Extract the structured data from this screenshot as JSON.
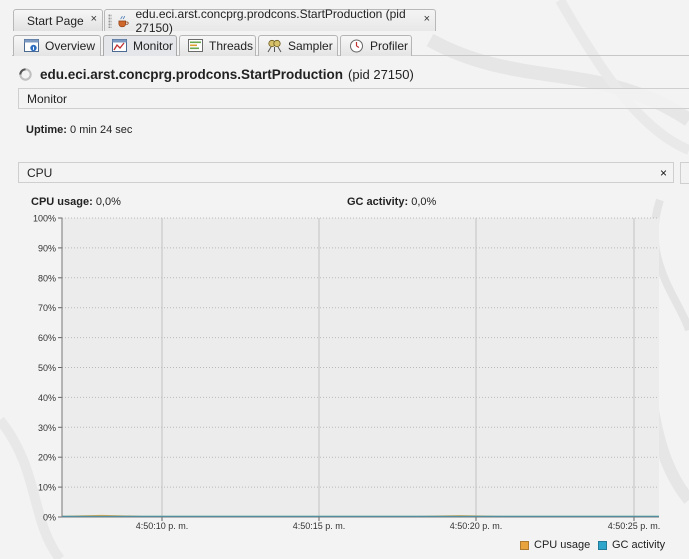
{
  "doc_tabs": {
    "start_page": "Start Page",
    "app_tab": "edu.eci.arst.concprg.prodcons.StartProduction (pid 27150)",
    "close_glyph": "×"
  },
  "sub_tabs": {
    "overview": "Overview",
    "monitor": "Monitor",
    "threads": "Threads",
    "sampler": "Sampler",
    "profiler": "Profiler"
  },
  "header": {
    "app_name": "edu.eci.arst.concprg.prodcons.StartProduction",
    "pid": "(pid 27150)"
  },
  "monitor": {
    "section_label": "Monitor",
    "uptime_label": "Uptime:",
    "uptime_value": "0 min 24 sec"
  },
  "cpu": {
    "section_label": "CPU",
    "close_glyph": "×",
    "cpu_usage_label": "CPU usage:",
    "cpu_usage_value": "0,0%",
    "gc_activity_label": "GC activity:",
    "gc_activity_value": "0,0%"
  },
  "colors": {
    "cpu_series": "#e8a33c",
    "gc_series": "#2ea6cc",
    "plot_bg": "#ececec"
  },
  "chart_data": {
    "type": "area",
    "ylim": [
      0,
      100
    ],
    "y_ticks": [
      "0%",
      "10%",
      "20%",
      "30%",
      "40%",
      "50%",
      "60%",
      "70%",
      "80%",
      "90%",
      "100%"
    ],
    "x_ticks": [
      "4:50:10 p. m.",
      "4:50:15 p. m.",
      "4:50:20 p. m.",
      "4:50:25 p. m."
    ],
    "series": [
      {
        "name": "CPU usage",
        "values": [
          0,
          0.3,
          0,
          0,
          0,
          0,
          0,
          0,
          0,
          0,
          0.2,
          0,
          0,
          0,
          0,
          0
        ]
      },
      {
        "name": "GC activity",
        "values": [
          0,
          0,
          0,
          0,
          0,
          0,
          0,
          0,
          0,
          0,
          0,
          0,
          0,
          0,
          0,
          0
        ]
      }
    ],
    "legend": "bottom-right",
    "grid": true
  }
}
